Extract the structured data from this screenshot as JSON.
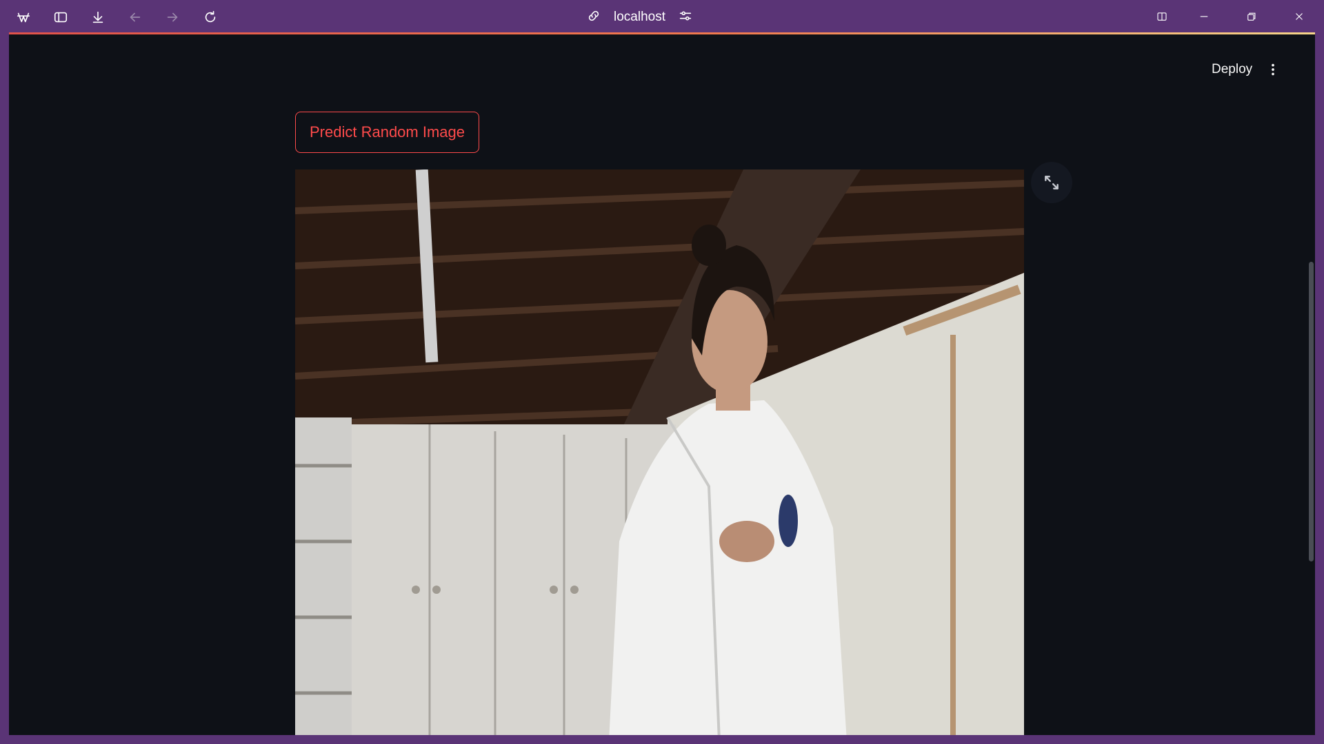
{
  "browser": {
    "url": "localhost",
    "icons": {
      "app": "app-logo-icon",
      "sidebar": "sidebar-toggle-icon",
      "download": "download-icon",
      "back": "back-arrow-icon",
      "forward": "forward-arrow-icon",
      "reload": "reload-icon",
      "link": "link-icon",
      "settings": "site-settings-icon",
      "split": "split-view-icon",
      "minimize": "minimize-icon",
      "restore": "restore-icon",
      "close": "close-icon"
    },
    "back_enabled": false,
    "forward_enabled": false
  },
  "app": {
    "deploy_label": "Deploy",
    "menu_icon": "kebab-menu-icon",
    "predict_button_label": "Predict Random Image",
    "image_alt": "Woman in white protective suit in a room with white cabinets",
    "fullscreen_icon": "fullscreen-expand-icon"
  },
  "colors": {
    "chrome": "#5a3476",
    "app_background": "#0e1117",
    "accent": "#ff4b4b"
  }
}
